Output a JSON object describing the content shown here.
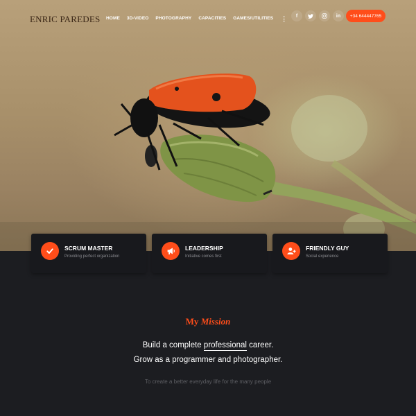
{
  "header": {
    "logo": "ENRIC PAREDES",
    "nav": [
      {
        "label": "HOME",
        "active": true
      },
      {
        "label": "3D-VIDEO"
      },
      {
        "label": "PHOTOGRAPHY"
      },
      {
        "label": "CAPACITIES"
      },
      {
        "label": "GAMES/UTILITIES"
      }
    ],
    "more_icon": "vertical-ellipsis-icon",
    "socials": [
      {
        "icon": "facebook-icon",
        "glyph": "f"
      },
      {
        "icon": "twitter-icon",
        "glyph": "t"
      },
      {
        "icon": "instagram-icon",
        "glyph": "◎"
      },
      {
        "icon": "linkedin-icon",
        "glyph": "in"
      }
    ],
    "phone": "+34 644447765"
  },
  "cards": [
    {
      "title": "SCRUM MASTER",
      "subtitle": "Providing perfect organization",
      "icon": "check-icon"
    },
    {
      "title": "LEADERSHIP",
      "subtitle": "Initiative comes first",
      "icon": "megaphone-icon"
    },
    {
      "title": "FRIENDLY GUY",
      "subtitle": "Social experience",
      "icon": "add-user-icon"
    }
  ],
  "mission": {
    "title_plain": "My",
    "title_emph": "Mission",
    "line1_before": "Build a complete",
    "line1_highlight": "professional",
    "line1_after": "career.",
    "line2": "Grow as a programmer and photographer.",
    "tagline": "To create a better everyday life for the many people"
  },
  "colors": {
    "accent": "#ff4d1a",
    "background": "#1c1d21",
    "card": "#18191d"
  }
}
